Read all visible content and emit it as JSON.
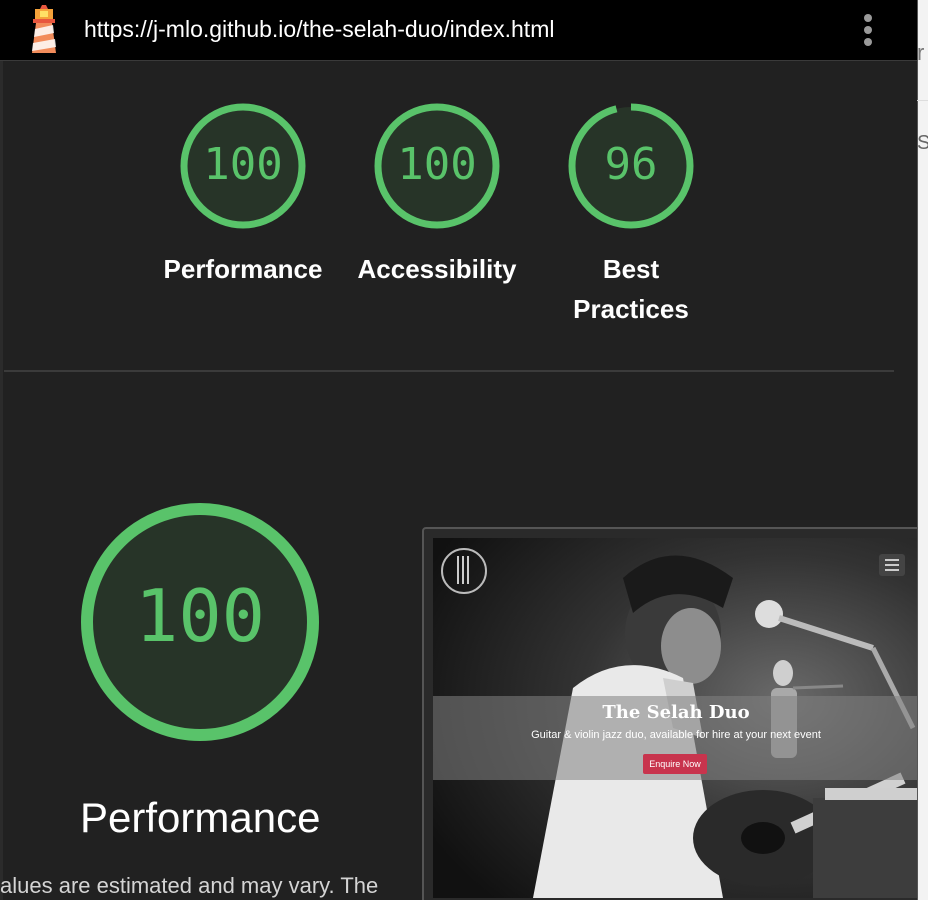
{
  "browser": {
    "url": "https://j-mlo.github.io/the-selah-duo/index.html",
    "logo_icon": "lighthouse-icon",
    "menu_icon": "kebab-menu-icon"
  },
  "gauges": [
    {
      "score": "100",
      "label": "Performance",
      "fraction": 1.0
    },
    {
      "score": "100",
      "label": "Accessibility",
      "fraction": 1.0
    },
    {
      "score": "96",
      "label_line1": "Best",
      "label_line2": "Practices",
      "fraction": 0.96
    }
  ],
  "performance_section": {
    "score": "100",
    "title": "Performance",
    "note": "alues are estimated and may vary. The"
  },
  "screenshot": {
    "site_title": "The Selah Duo",
    "site_subtitle": "Guitar & violin jazz duo, available for hire at your next event",
    "cta_label": "Enquire Now"
  },
  "colors": {
    "pass_green": "#59c36a",
    "gauge_fill": "#273428",
    "background": "#212121",
    "cta": "#c8344d"
  }
}
